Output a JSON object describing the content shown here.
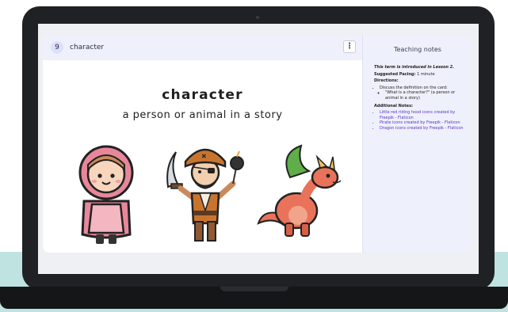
{
  "card": {
    "number": "9",
    "header_term": "character",
    "menu_icon": "⋮",
    "term": "character",
    "definition": "a person or animal in a story",
    "illustrations": [
      "little-red-riding-hood-icon",
      "pirate-icon",
      "dragon-icon"
    ]
  },
  "notes": {
    "title": "Teaching notes",
    "intro_italic": "This term is introduced in Lesson 2.",
    "pacing_label": "Suggested Pacing:",
    "pacing_value": "1 minute",
    "directions_label": "Directions:",
    "direction_item": "Discuss the definition on the card:",
    "direction_sub": "\"What is a character?\" (a person or animal in a story)",
    "additional_label": "Additional Notes:",
    "links": [
      "Little red riding hood icons created by Freepik - Flaticon",
      "Pirate icons created by Freepik - Flaticon",
      "Dragon icons created by Freepik - Flaticon"
    ]
  },
  "colors": {
    "accent": "#5b31c9",
    "header_bg": "#eef0fb",
    "teal_background": "#bfe3e1",
    "laptop_frame": "#1f2124"
  }
}
